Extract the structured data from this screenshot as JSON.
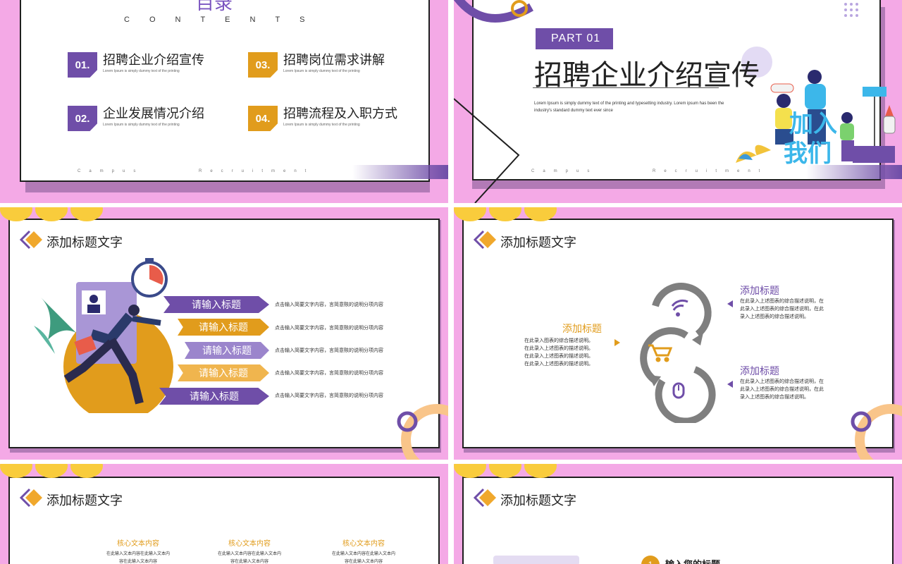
{
  "slide1": {
    "title": "目录",
    "contents_label": "CONTENTS",
    "items": [
      {
        "num": "01.",
        "title": "招聘企业介绍宣传",
        "desc": "Lorem Ipsum is simply dummy text of the printing"
      },
      {
        "num": "02.",
        "title": "企业发展情况介绍",
        "desc": "Lorem Ipsum is simply dummy text of the printing"
      },
      {
        "num": "03.",
        "title": "招聘岗位需求讲解",
        "desc": "Lorem Ipsum is simply dummy text of the printing"
      },
      {
        "num": "04.",
        "title": "招聘流程及入职方式",
        "desc": "Lorem Ipsum is simply dummy text of the printing"
      }
    ],
    "footer_a": "Campus",
    "footer_b": "Recruitment"
  },
  "slide2": {
    "part": "PART 01",
    "title": "招聘企业介绍宣传",
    "desc": "Lorem Ipsum  is simply dummy text  of the printing and typesetting industry. Lorem ipsum has been the industry's standard dummy text ever since",
    "join_1": "加入",
    "join_2": "我们",
    "footer_a": "Campus",
    "footer_b": "Recruitment"
  },
  "slide3": {
    "header": "添加标题文字",
    "items": [
      {
        "label": "请输入标题",
        "desc": "点击输入简要文字内容，言简意赅的说明分项内容",
        "color": "#6f4ea8"
      },
      {
        "label": "请输入标题",
        "desc": "点击输入简要文字内容，言简意赅的说明分项内容",
        "color": "#e19c1c"
      },
      {
        "label": "请输入标题",
        "desc": "点击输入简要文字内容，言简意赅的说明分项内容",
        "color": "#9b85cc"
      },
      {
        "label": "请输入标题",
        "desc": "点击输入简要文字内容，言简意赅的说明分项内容",
        "color": "#f0b54e"
      },
      {
        "label": "请输入标题",
        "desc": "点击输入简要文字内容，言简意赅的说明分项内容",
        "color": "#6f4ea8"
      }
    ]
  },
  "slide4": {
    "header": "添加标题文字",
    "left": {
      "title": "添加标题",
      "desc": [
        "在此录入图表的综合描述说明。",
        "在此录入上述图表的描述说明。",
        "在此录入上述图表的描述说明。",
        "在此录入上述图表的描述说明。"
      ]
    },
    "right_top": {
      "title": "添加标题",
      "desc": [
        "在此录入上述图表的综合描述说明，在",
        "此录入上述图表的综合描述说明，在此",
        "录入上述图表的综合描述说明。"
      ]
    },
    "right_bottom": {
      "title": "添加标题",
      "desc": [
        "在此录入上述图表的综合描述说明，在",
        "此录入上述图表的综合描述说明，在此",
        "录入上述图表的综合描述说明。"
      ]
    }
  },
  "slide5": {
    "header": "添加标题文字",
    "cores": [
      {
        "title": "核心文本内容",
        "line1": "在此输入文本内容在此输入文本内",
        "line2": "容在此输入文本内容"
      },
      {
        "title": "核心文本内容",
        "line1": "在此输入文本内容在此输入文本内",
        "line2": "容在此输入文本内容"
      },
      {
        "title": "核心文本内容",
        "line1": "在此输入文本内容在此输入文本内",
        "line2": "容在此输入文本内容"
      }
    ]
  },
  "slide6": {
    "header": "添加标题文字",
    "step_num": "1",
    "step_title": "输入您的标题"
  },
  "colors": {
    "purple": "#6f4ea8",
    "orange": "#e19c1c",
    "pink": "#f4a9e6",
    "yellow": "#f9cc3c",
    "gray": "#7f7f7f"
  }
}
